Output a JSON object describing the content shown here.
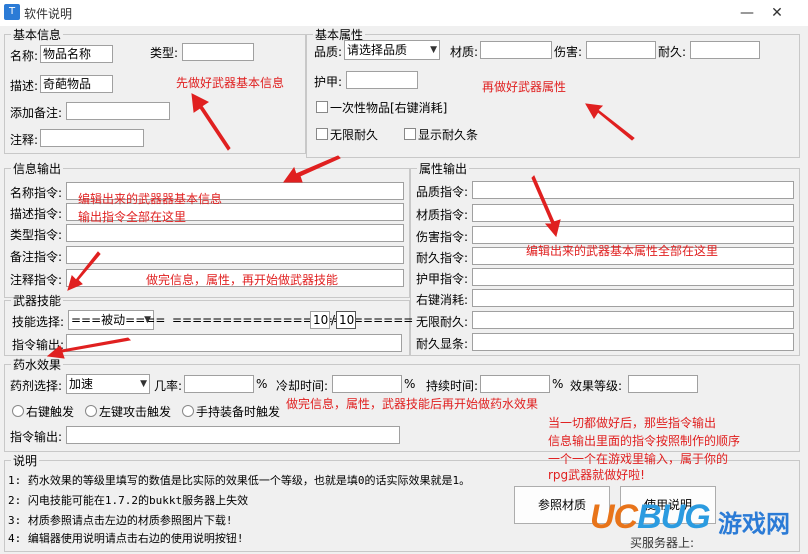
{
  "window": {
    "title": "软件说明",
    "minimize": "—",
    "close": "✕"
  },
  "basic": {
    "legend": "基本信息",
    "name_label": "名称:",
    "name_value": "物品名称",
    "type_label": "类型:",
    "type_value": "",
    "desc_label": "描述:",
    "desc_value": "奇葩物品",
    "remark_label": "添加备注:",
    "remark_value": "",
    "note_label": "注释:",
    "note_value": ""
  },
  "attrs": {
    "legend": "基本属性",
    "quality_label": "品质:",
    "quality_value": "请选择品质",
    "material_label": "材质:",
    "material_value": "",
    "damage_label": "伤害:",
    "damage_value": "",
    "durability_label": "耐久:",
    "durability_value": "",
    "armor_label": "护甲:",
    "armor_value": "",
    "onetime_label": "一次性物品[右键消耗]",
    "infinite_label": "无限耐久",
    "show_dur_label": "显示耐久条"
  },
  "info_out": {
    "legend": "信息输出",
    "rows": [
      "名称指令:",
      "描述指令:",
      "类型指令:",
      "备注指令:",
      "注释指令:"
    ]
  },
  "attr_out": {
    "legend": "属性输出",
    "rows": [
      "品质指令:",
      "材质指令:",
      "伤害指令:",
      "耐久指令:",
      "护甲指令:",
      "右键消耗:",
      "无限耐久:",
      "耐久显条:"
    ]
  },
  "skill": {
    "legend": "武器技能",
    "select_label": "技能选择:",
    "select_value": "===被动====",
    "separator": "========================",
    "level": "10",
    "slash": "/",
    "max": "10",
    "output_label": "指令输出:"
  },
  "potion": {
    "legend": "药水效果",
    "select_label": "药剂选择:",
    "select_value": "加速",
    "chance_label": "几率:",
    "pct1": "%",
    "cool_label": "冷却时间:",
    "pct2": "%",
    "duration_label": "持续时间:",
    "pct3": "%",
    "level_label": "效果等级:",
    "r1": "右键触发",
    "r2": "左键攻击触发",
    "r3": "手持装备时触发",
    "output_label": "指令输出:"
  },
  "explain": {
    "legend": "说明",
    "lines": [
      "1: 药水效果的等级里填写的数值是比实际的效果低一个等级，也就是填0的话实际效果就是1。",
      "2: 闪电技能可能在1.7.2的bukkt服务器上失效",
      "3: 材质参照请点击左边的材质参照图片下载!",
      "4: 编辑器使用说明请点击右边的使用说明按钮!"
    ],
    "btn_material": "参照材质",
    "btn_usage": "使用说明"
  },
  "annotations": {
    "a1": "先做好武器基本信息",
    "a2": "再做好武器属性",
    "a3a": "编辑出来的武器器基本信息",
    "a3b": "输出指令全部在这里",
    "a4": "编辑出来的武器基本属性全部在这里",
    "a5": "做完信息，属性，再开始做武器技能",
    "a6": "做完信息，属性，武器技能后再开始做药水效果",
    "a7a": "当一切都做好后，那些指令输出",
    "a7b": "信息输出里面的指令按照制作的顺序",
    "a7c": "一个一个在游戏里输入，属于你的",
    "a7d": "rpg武器就做好啦!"
  },
  "watermark": {
    "logo": "UCBUG",
    "suffix": "游戏网",
    "tag": "买服务器上:"
  },
  "colors": {
    "annotation": "#e02020",
    "accent": "#2b7bd6"
  }
}
